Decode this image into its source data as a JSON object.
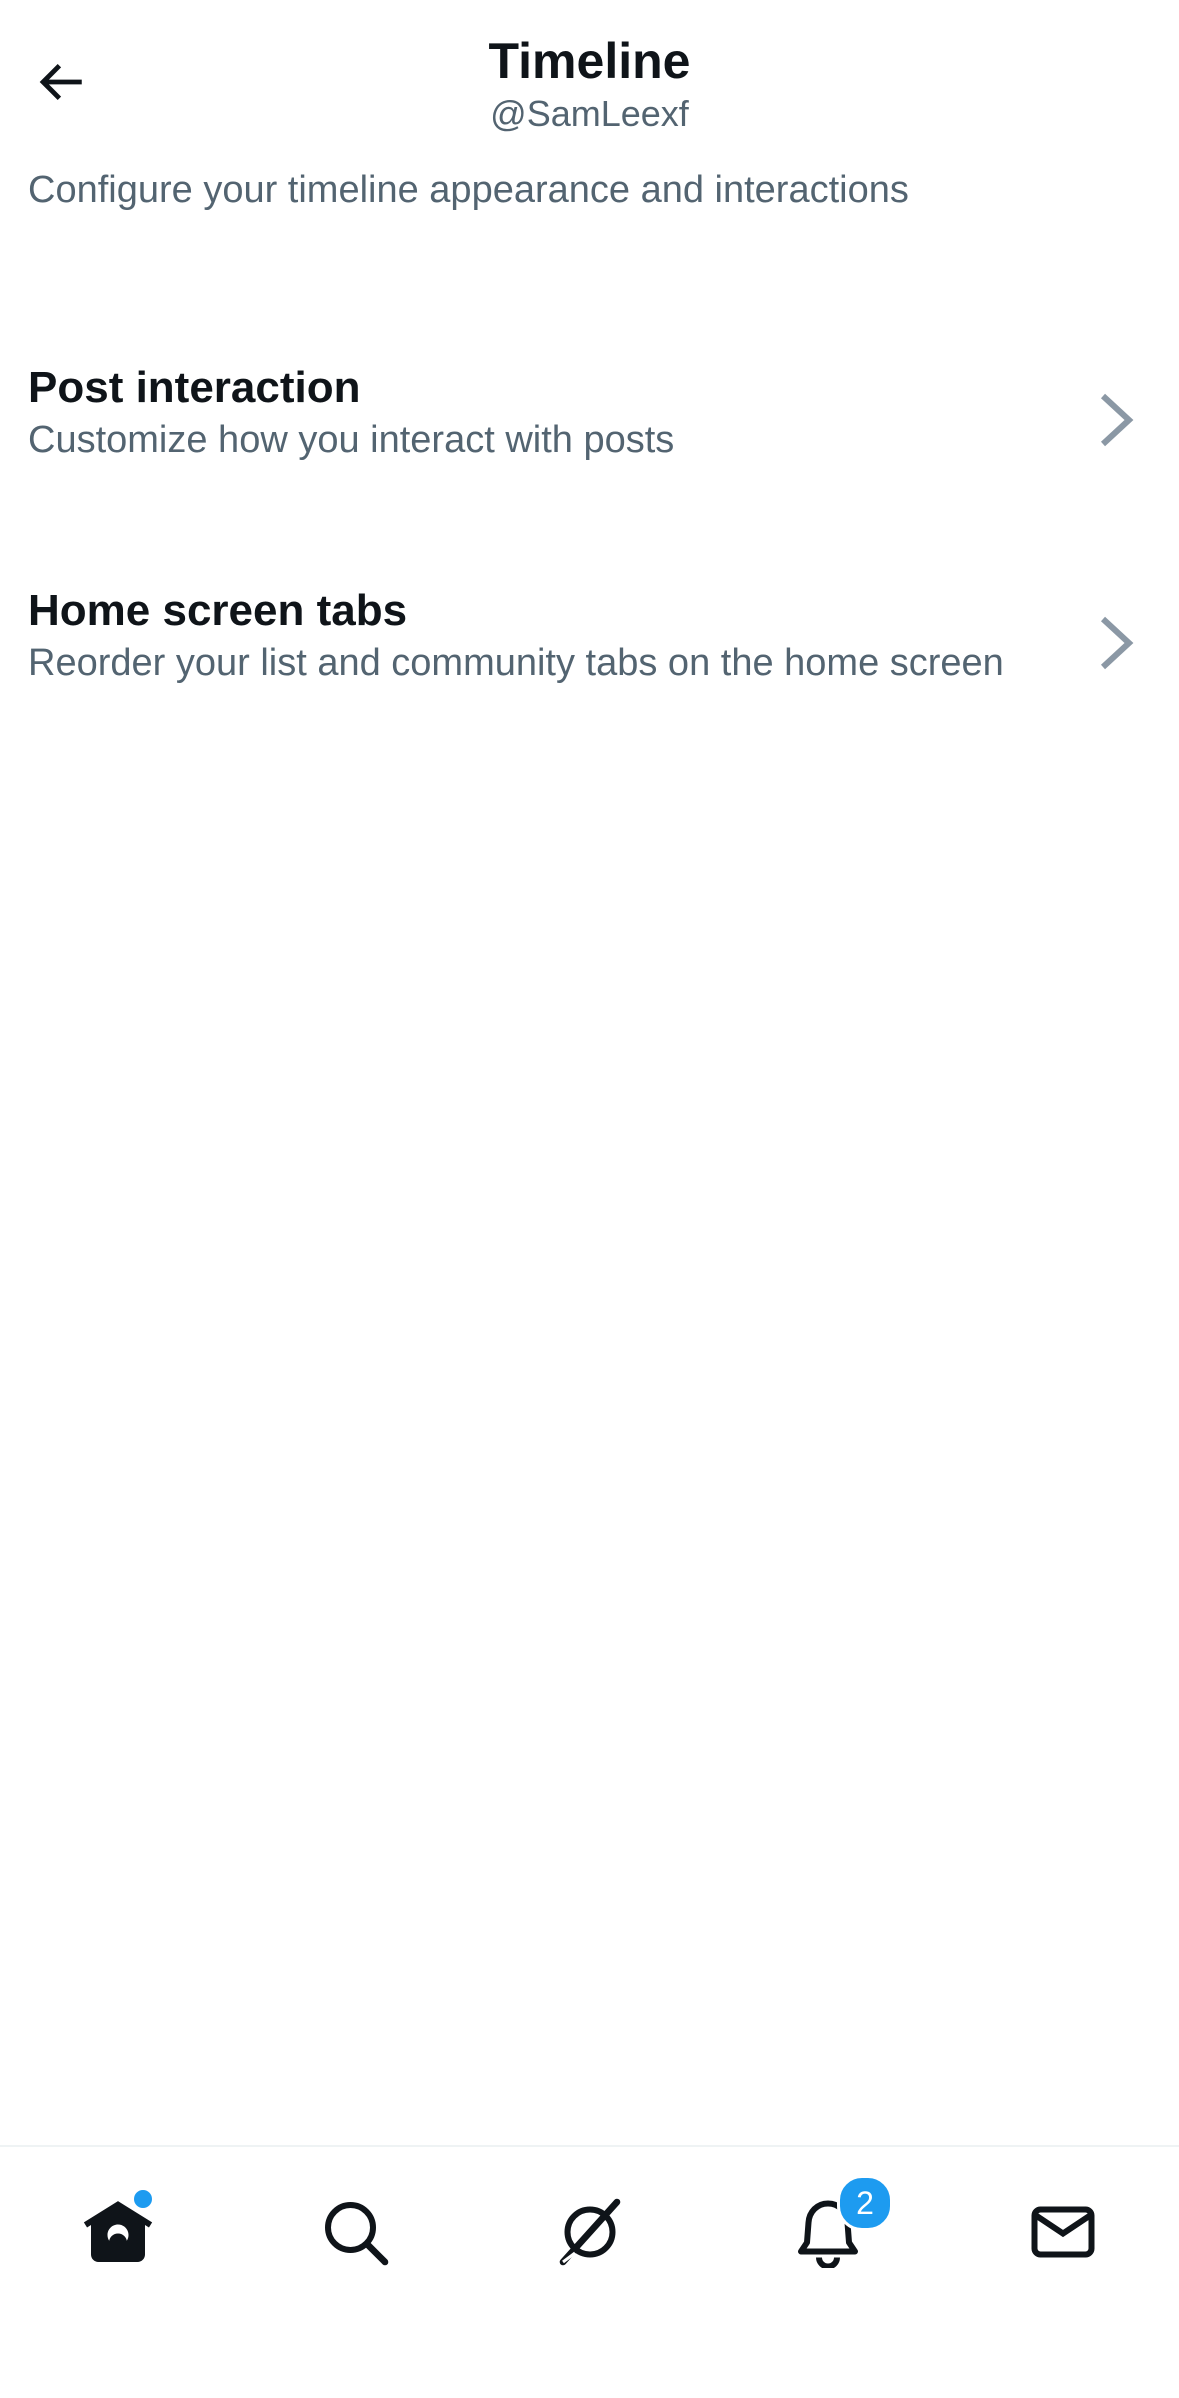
{
  "header": {
    "title": "Timeline",
    "handle": "@SamLeexf",
    "back_icon": "arrow-left-icon"
  },
  "description": "Configure your timeline appearance and interactions",
  "items": [
    {
      "title": "Post interaction",
      "subtitle": "Customize how you interact with posts",
      "icon": "chevron-right-icon"
    },
    {
      "title": "Home screen tabs",
      "subtitle": "Reorder your list and community tabs on the home screen",
      "icon": "chevron-right-icon"
    }
  ],
  "bottom_nav": {
    "home_icon": "home-icon",
    "search_icon": "search-icon",
    "grok_icon": "grok-icon",
    "notifications_icon": "bell-icon",
    "notifications_badge": "2",
    "messages_icon": "envelope-icon"
  },
  "colors": {
    "accent": "#1d9bf0",
    "text_primary": "#0f1419",
    "text_secondary": "#536471",
    "chevron": "#8b98a5"
  }
}
